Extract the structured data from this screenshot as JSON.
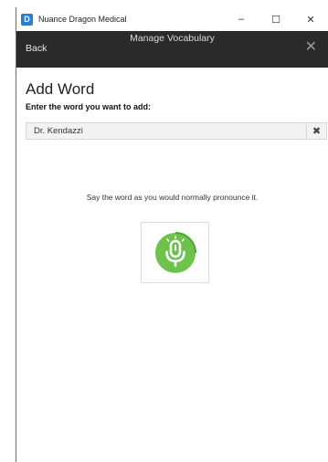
{
  "window": {
    "title": "Nuance Dragon Medical",
    "minimize_glyph": "–",
    "maximize_glyph": "☐",
    "close_glyph": "✕"
  },
  "header": {
    "back_label": "Back",
    "title": "Manage Vocabulary",
    "close_glyph": "✕"
  },
  "main": {
    "heading": "Add Word",
    "field_label": "Enter the word you want to add:",
    "word_value": "Dr. Kendazzi",
    "clear_glyph": "✖",
    "instruction": "Say the word as you would normally pronounce it."
  },
  "icons": {
    "app": "dragon-app-icon",
    "mic": "microphone-icon"
  },
  "colors": {
    "accent": "#2b7cd3",
    "header_bg": "#2a2a2a",
    "mic_green": "#6cc24a"
  }
}
